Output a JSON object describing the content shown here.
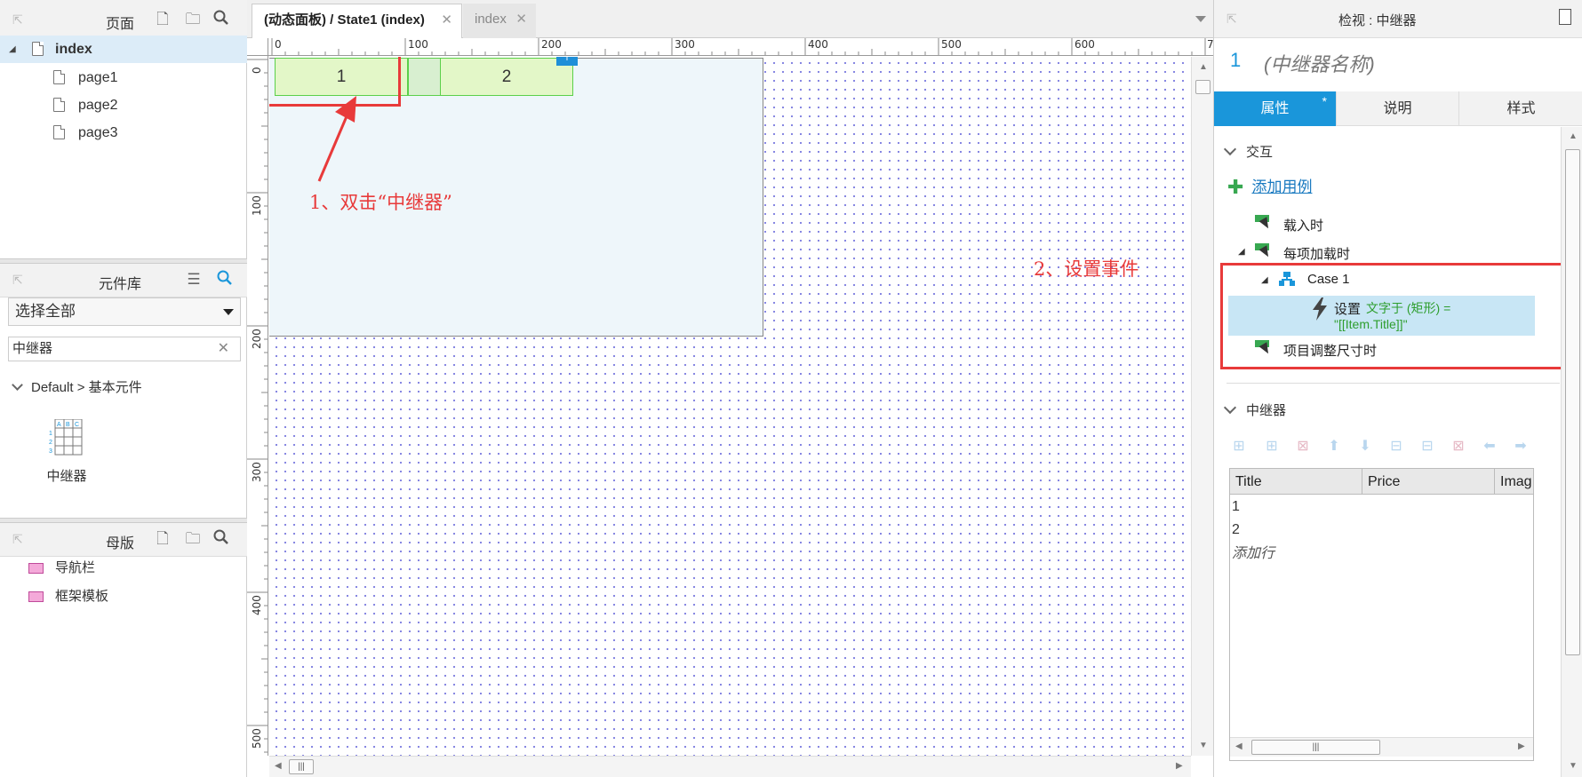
{
  "left": {
    "pages": {
      "title": "页面",
      "items": [
        {
          "label": "index",
          "selected": true
        },
        {
          "label": "page1"
        },
        {
          "label": "page2"
        },
        {
          "label": "page3"
        }
      ]
    },
    "library": {
      "title": "元件库",
      "select_value": "选择全部",
      "search_value": "中继器",
      "category": "Default > 基本元件",
      "widget_label": "中继器"
    },
    "masters": {
      "title": "母版",
      "items": [
        "导航栏",
        "框架模板"
      ]
    }
  },
  "center": {
    "tabs": [
      {
        "label": "(动态面板) / State1 (index)",
        "active": true
      },
      {
        "label": "index",
        "active": false
      }
    ],
    "ruler_h": [
      "0",
      "100",
      "200",
      "300",
      "400",
      "500",
      "600",
      "7"
    ],
    "ruler_v": [
      "0",
      "100",
      "200",
      "300",
      "400",
      "500"
    ],
    "repeater_items": [
      "1",
      "2"
    ],
    "annotation1": "1、双击“中继器”",
    "annotation2": "2、设置事件"
  },
  "right": {
    "header_title": "检视 : 中继器",
    "widget_number": "1",
    "widget_name": "(中继器名称)",
    "tabs": [
      {
        "label": "属性",
        "active": true,
        "marker": "*"
      },
      {
        "label": "说明",
        "active": false
      },
      {
        "label": "样式",
        "active": false
      }
    ],
    "interactions": {
      "section_title": "交互",
      "add_case": "添加用例",
      "events": [
        "载入时",
        "每项加载时",
        "项目调整尺寸时"
      ],
      "case_label": "Case 1",
      "action_prefix": "设置",
      "action_text": "文字于 (矩形) =",
      "action_value": "\"[[Item.Title]]\""
    },
    "repeater": {
      "section_title": "中继器",
      "columns": [
        "Title",
        "Price",
        "Imag"
      ],
      "rows": [
        [
          "1"
        ],
        [
          "2"
        ]
      ],
      "add_row": "添加行"
    },
    "colors": {
      "accent": "#1a96da",
      "annotation": "#e83a3a",
      "green_link": "#2e9e2e"
    }
  }
}
